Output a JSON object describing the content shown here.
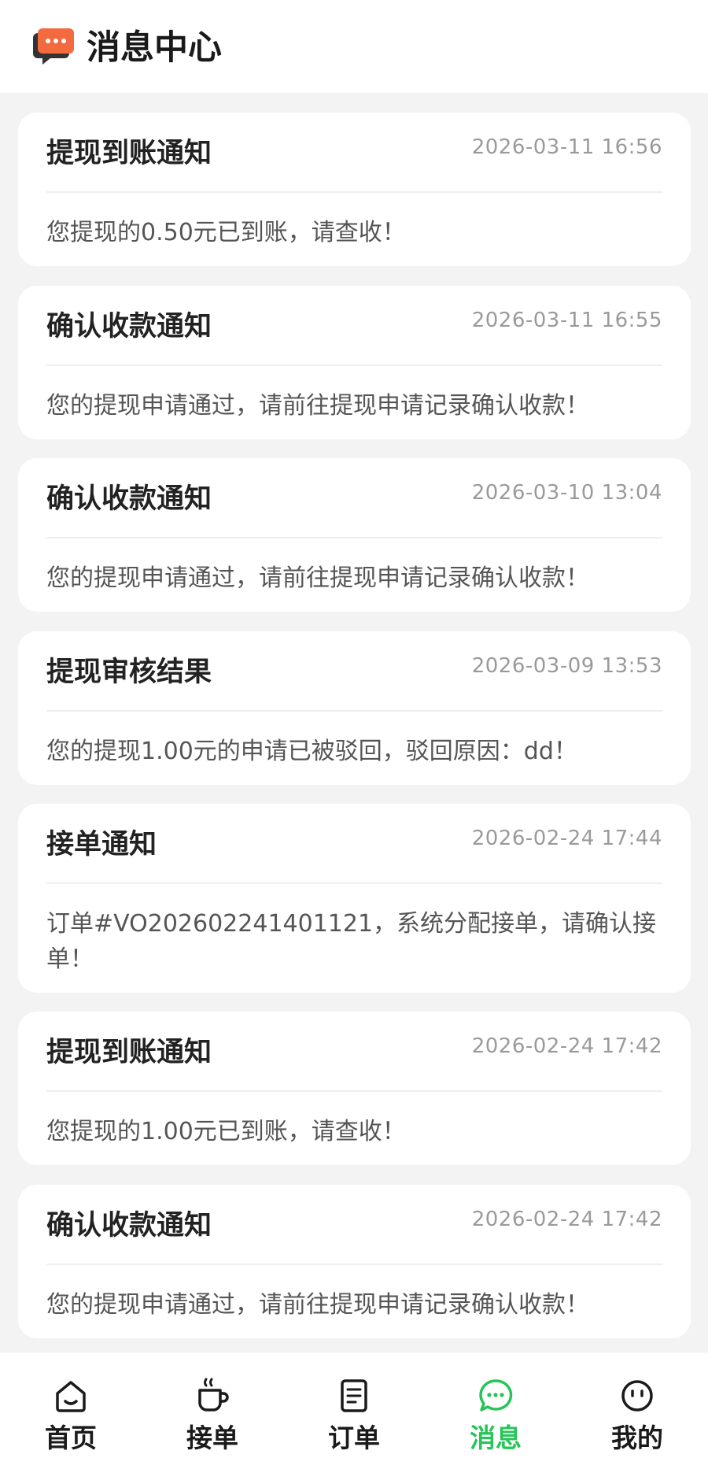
{
  "header": {
    "title": "消息中心",
    "icon": "chat-bubble-icon",
    "icon_color": "#f26a3d"
  },
  "messages": [
    {
      "title": "提现到账通知",
      "time": "2026-03-11 16:56",
      "body": "您提现的0.50元已到账，请查收！"
    },
    {
      "title": "确认收款通知",
      "time": "2026-03-11 16:55",
      "body": "您的提现申请通过，请前往提现申请记录确认收款！"
    },
    {
      "title": "确认收款通知",
      "time": "2026-03-10 13:04",
      "body": "您的提现申请通过，请前往提现申请记录确认收款！"
    },
    {
      "title": "提现审核结果",
      "time": "2026-03-09 13:53",
      "body": "您的提现1.00元的申请已被驳回，驳回原因：dd！"
    },
    {
      "title": "接单通知",
      "time": "2026-02-24 17:44",
      "body": "订单#VO202602241401121，系统分配接单，请确认接单！"
    },
    {
      "title": "提现到账通知",
      "time": "2026-02-24 17:42",
      "body": "您提现的1.00元已到账，请查收！"
    },
    {
      "title": "确认收款通知",
      "time": "2026-02-24 17:42",
      "body": "您的提现申请通过，请前往提现申请记录确认收款！"
    }
  ],
  "tabbar": {
    "active_color": "#27c45a",
    "tabs": [
      {
        "label": "首页",
        "icon": "home-icon"
      },
      {
        "label": "接单",
        "icon": "cup-icon"
      },
      {
        "label": "订单",
        "icon": "document-icon"
      },
      {
        "label": "消息",
        "icon": "chat-icon",
        "active": true
      },
      {
        "label": "我的",
        "icon": "smiley-icon"
      }
    ]
  }
}
